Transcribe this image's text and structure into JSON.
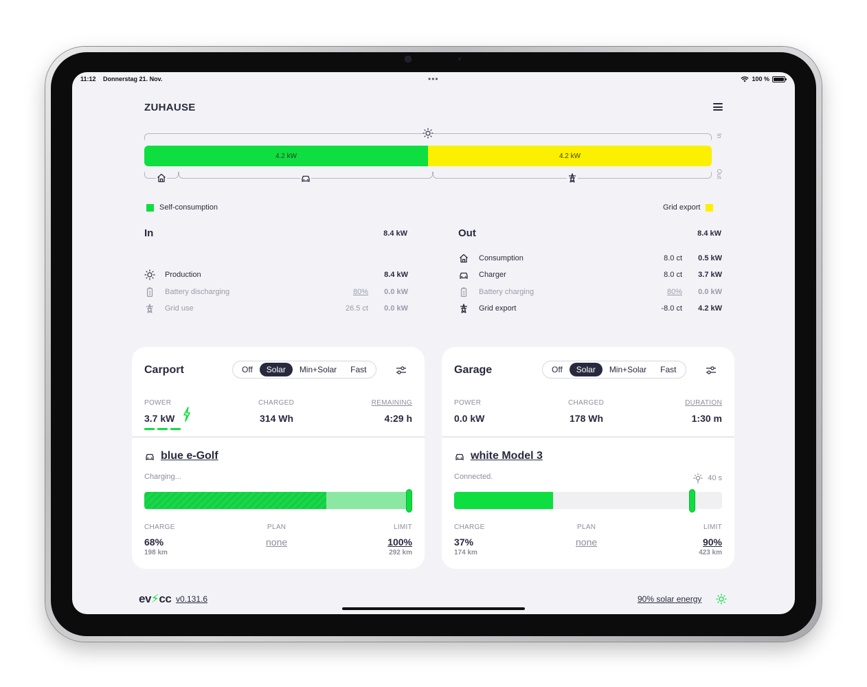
{
  "statusbar": {
    "time": "11:12",
    "date": "Donnerstag 21. Nov.",
    "battery": "100 %"
  },
  "site_title": "ZUHAUSE",
  "flow": {
    "self_consumption_value": "4.2 kW",
    "grid_export_value": "4.2 kW",
    "self_consumption_fraction": 0.5,
    "in_label": "In",
    "out_label": "Out"
  },
  "legend": {
    "self_consumption": "Self-consumption",
    "grid_export": "Grid export"
  },
  "colors": {
    "self_consumption": "#0fde41",
    "grid_export": "#faf000",
    "dark": "#28293e"
  },
  "in": {
    "title": "In",
    "total": "8.4 kW",
    "rows": [
      {
        "icon": "sun-icon",
        "label": "Production",
        "price": "",
        "value": "8.4 kW"
      },
      {
        "icon": "battery-icon",
        "label": "Battery discharging",
        "price": "80%",
        "value": "0.0 kW"
      },
      {
        "icon": "grid-tower-icon",
        "label": "Grid use",
        "price": "26.5 ct",
        "value": "0.0 kW"
      }
    ]
  },
  "out": {
    "title": "Out",
    "total": "8.4 kW",
    "rows": [
      {
        "icon": "house-icon",
        "label": "Consumption",
        "price": "8.0 ct",
        "value": "0.5 kW"
      },
      {
        "icon": "car-icon",
        "label": "Charger",
        "price": "8.0 ct",
        "value": "3.7 kW"
      },
      {
        "icon": "battery-icon",
        "label": "Battery charging",
        "price": "80%",
        "value": "0.0 kW"
      },
      {
        "icon": "grid-tower-icon",
        "label": "Grid export",
        "price": "-8.0 ct",
        "value": "4.2 kW"
      }
    ]
  },
  "modes": [
    "Off",
    "Solar",
    "Min+Solar",
    "Fast"
  ],
  "loadpoints": [
    {
      "title": "Carport",
      "active_mode": "Solar",
      "power_label": "POWER",
      "power": "3.7 kW",
      "charged_label": "CHARGED",
      "charged": "314 Wh",
      "third_label": "REMAINING",
      "third": "4:29 h",
      "vehicle": "blue e-Golf",
      "status": "Charging...",
      "charge_label": "CHARGE",
      "charge": "68%",
      "charge_range": "198 km",
      "plan_label": "PLAN",
      "plan": "none",
      "limit_label": "LIMIT",
      "limit": "100%",
      "limit_range": "292 km",
      "soc_fraction": 0.68,
      "limit_fraction": 1.0
    },
    {
      "title": "Garage",
      "active_mode": "Solar",
      "power_label": "POWER",
      "power": "0.0 kW",
      "charged_label": "CHARGED",
      "charged": "178 Wh",
      "third_label": "DURATION",
      "third": "1:30 m",
      "vehicle": "white Model 3",
      "status": "Connected.",
      "timer": "40 s",
      "charge_label": "CHARGE",
      "charge": "37%",
      "charge_range": "174 km",
      "plan_label": "PLAN",
      "plan": "none",
      "limit_label": "LIMIT",
      "limit": "90%",
      "limit_range": "423 km",
      "soc_fraction": 0.37,
      "limit_fraction": 0.9
    }
  ],
  "footer": {
    "logo_left": "ev",
    "logo_right": "cc",
    "version": "v0.131.6",
    "solar": "90% solar energy"
  }
}
